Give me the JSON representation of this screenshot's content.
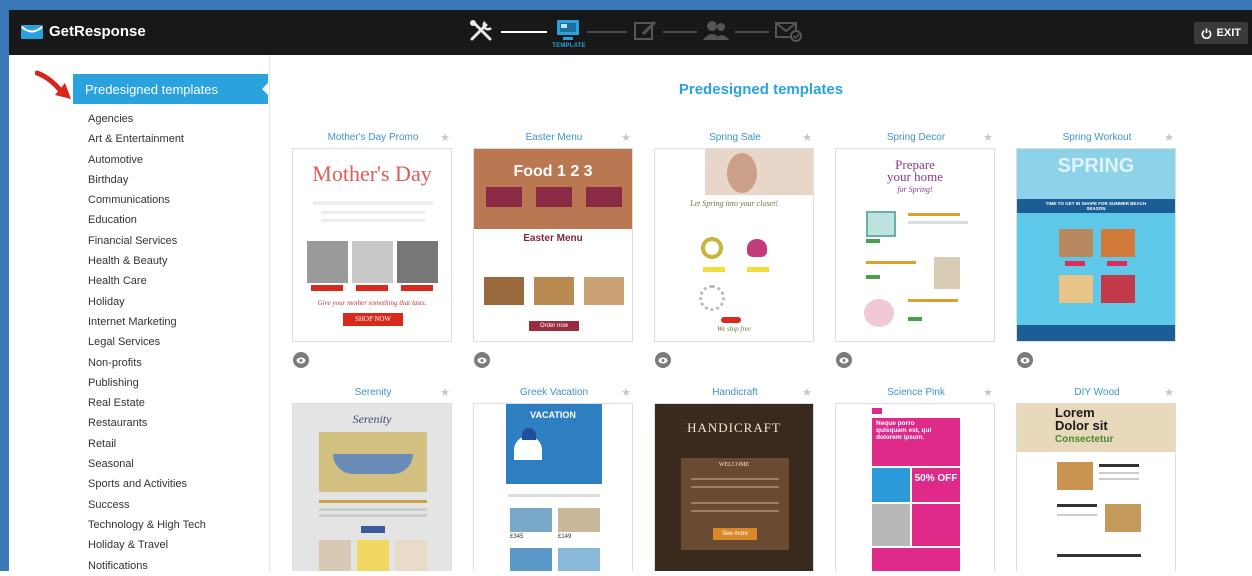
{
  "app": {
    "logo_text": "GetResponse",
    "exit_label": "EXIT",
    "accent_color": "#2aa2de"
  },
  "wizard": {
    "active_step_label": "TEMPLATE",
    "steps": [
      "settings-tools-icon",
      "template-icon",
      "edit-icon",
      "recipients-icon",
      "send-icon"
    ]
  },
  "sidebar": {
    "active_label": "Predesigned templates",
    "categories": [
      "Agencies",
      "Art & Entertainment",
      "Automotive",
      "Birthday",
      "Communications",
      "Education",
      "Financial Services",
      "Health & Beauty",
      "Health Care",
      "Holiday",
      "Internet Marketing",
      "Legal Services",
      "Non-profits",
      "Publishing",
      "Real Estate",
      "Restaurants",
      "Retail",
      "Seasonal",
      "Sports and Activities",
      "Success",
      "Technology & High Tech",
      "Holiday & Travel",
      "Notifications"
    ]
  },
  "main": {
    "title": "Predesigned templates",
    "templates": [
      {
        "title": "Mother's Day Promo",
        "preview_lines": [
          "Mother's Day",
          "Give your mother something that lasts.",
          "SHOP NOW"
        ]
      },
      {
        "title": "Easter Menu",
        "preview_lines": [
          "Food 1 2 3",
          "Easter Menu",
          "Order now"
        ]
      },
      {
        "title": "Spring Sale",
        "preview_lines": [
          "Let Spring into your closet!",
          "We ship free"
        ]
      },
      {
        "title": "Spring Decor",
        "preview_lines": [
          "Prepare",
          "your home",
          "for Spring!"
        ]
      },
      {
        "title": "Spring Workout",
        "preview_lines": [
          "SPRING",
          "TIME TO GET IN SHAPE FOR SUMMER BEACH SEASON"
        ]
      },
      {
        "title": "Serenity",
        "preview_lines": [
          "Serenity"
        ]
      },
      {
        "title": "Greek Vacation",
        "preview_lines": [
          "VACATION",
          "£345",
          "£149"
        ]
      },
      {
        "title": "Handicraft",
        "preview_lines": [
          "HANDICRAFT",
          "WELCOME",
          "See more"
        ]
      },
      {
        "title": "Science Pink",
        "preview_lines": [
          "Neque porro quisquam est, qui dolorem ipsum.",
          "50% OFF"
        ]
      },
      {
        "title": "DIY Wood",
        "preview_lines": [
          "Lorem",
          "Dolor sit",
          "Consectetur"
        ]
      }
    ]
  }
}
